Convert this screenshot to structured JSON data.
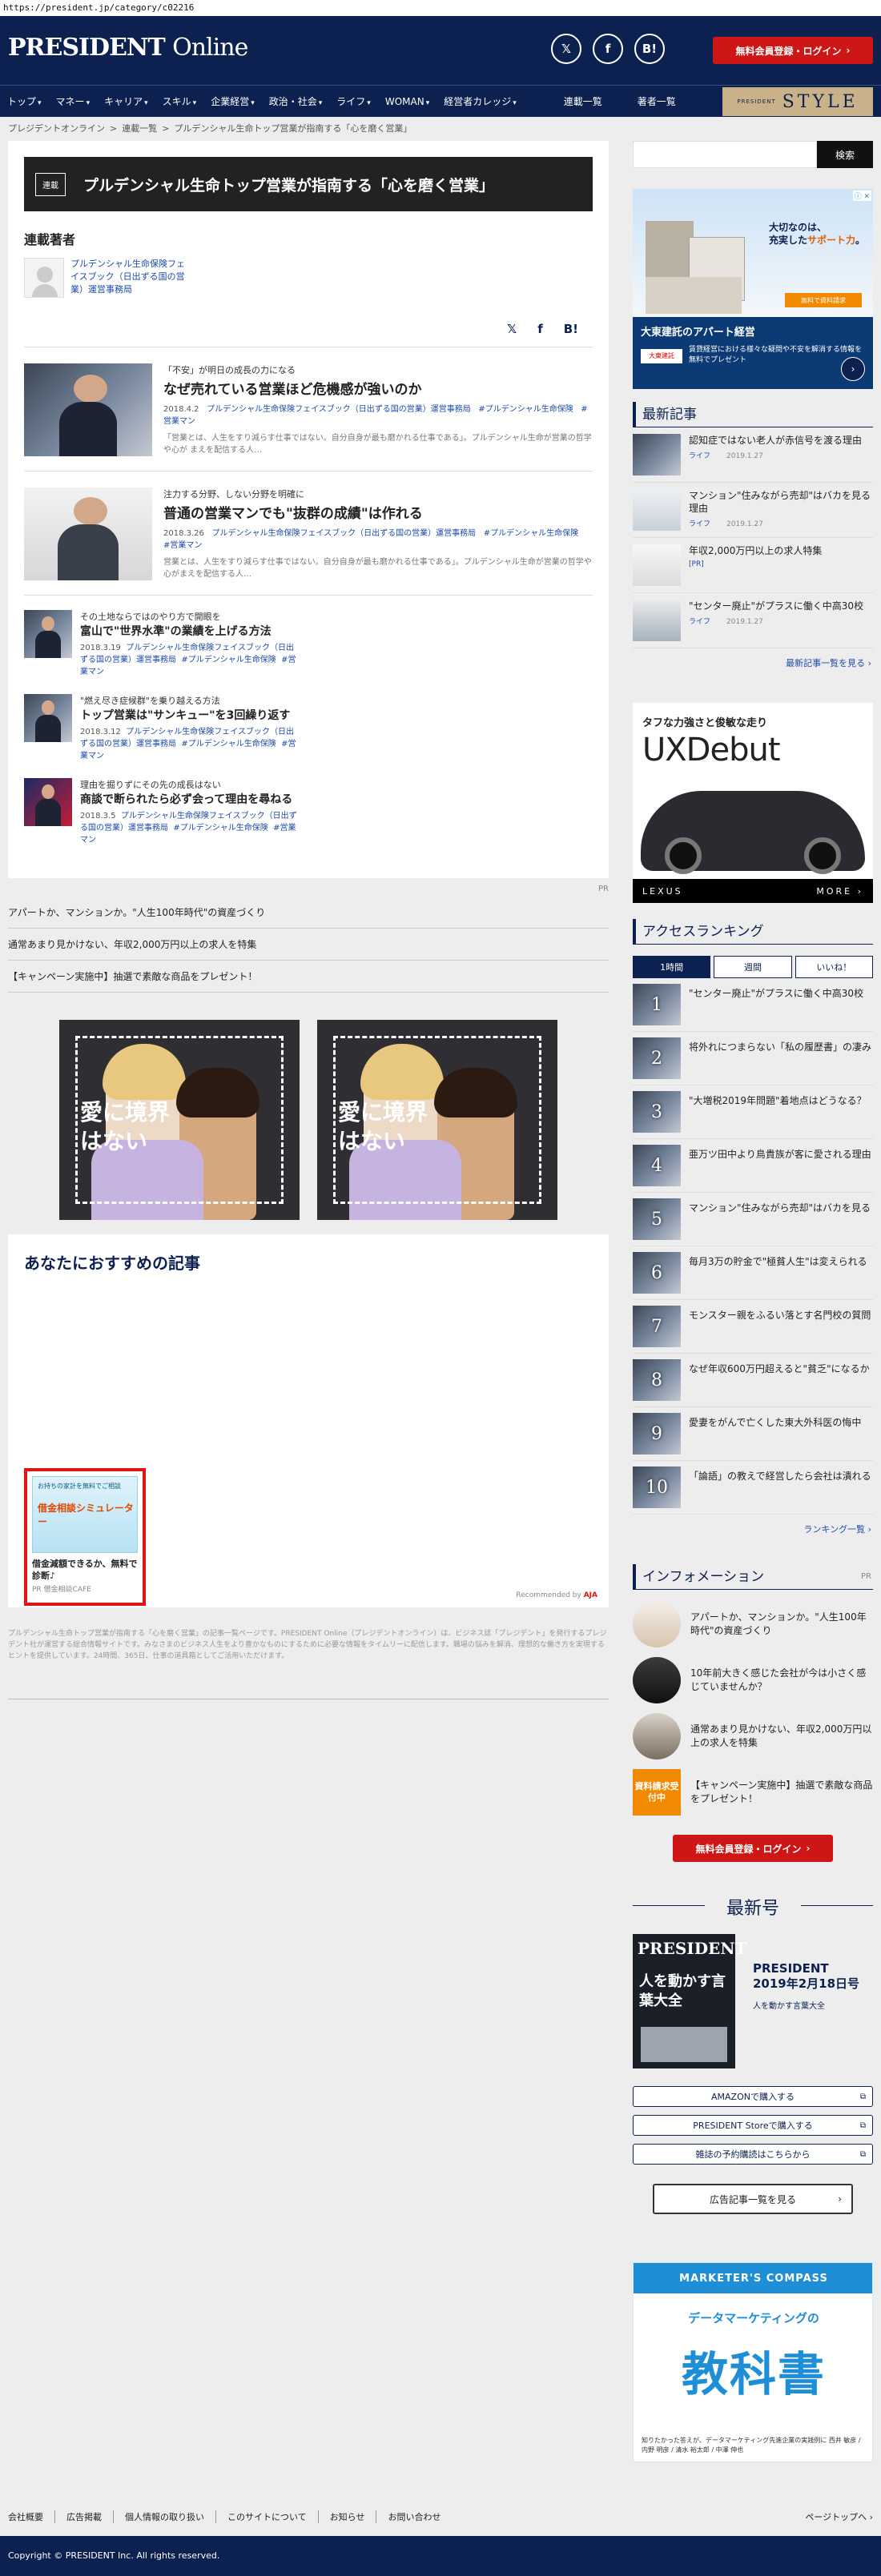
{
  "url": "https://president.jp/category/c02216",
  "header": {
    "logo_main": "PRESIDENT",
    "logo_sub": "Online",
    "social": [
      "twitter-icon",
      "facebook-icon",
      "hatena-icon"
    ],
    "social_labels": [
      "𝕏",
      "f",
      "B!"
    ],
    "register_label": "無料会員登録・ログイン",
    "register_chevron": "›"
  },
  "nav": {
    "items": [
      "トップ",
      "マネー",
      "キャリア",
      "スキル",
      "企業経営",
      "政治・社会",
      "ライフ",
      "WOMAN",
      "経営者カレッジ"
    ],
    "caret": "▾",
    "side_items": [
      "連載一覧",
      "著者一覧"
    ],
    "style_prefix": "PRESIDENT",
    "style_word": "STYLE"
  },
  "breadcrumb": [
    "プレジデントオンライン",
    "連載一覧",
    "プルデンシャル生命トップ営業が指南する「心を磨く営業」"
  ],
  "breadcrumb_sep": ">",
  "series": {
    "tag": "連載",
    "title": "プルデンシャル生命トップ営業が指南する「心を磨く営業」",
    "authors_heading": "連載著者",
    "author_name": "プルデンシャル生命保険フェイスブック（日出ずる国の営業）運営事務局",
    "share_labels": [
      "𝕏",
      "f",
      "B!"
    ]
  },
  "articles_big": [
    {
      "kicker": "「不安」が明日の成長の力になる",
      "title": "なぜ売れている営業ほど危機感が強いのか",
      "date": "2018.4.2",
      "author": "プルデンシャル生命保険フェイスブック（日出ずる国の営業）運営事務局",
      "tags": [
        "#プルデンシャル生命保険",
        "#営業マン"
      ],
      "desc": "「営業とは、人生をすり減らす仕事ではない。自分自身が最も磨かれる仕事である」。プルデンシャル生命が営業の哲学や心が まえを配信する人…"
    },
    {
      "kicker": "注力する分野、しない分野を明確に",
      "title": "普通の営業マンでも\"抜群の成績\"は作れる",
      "date": "2018.3.26",
      "author": "プルデンシャル生命保険フェイスブック（日出ずる国の営業）運営事務局",
      "tags": [
        "#プルデンシャル生命保険",
        "#営業マン"
      ],
      "desc": "営業とは、人生をすり減らす仕事ではない。自分自身が最も磨かれる仕事である」。プルデンシャル生命が営業の哲学や心がまえを配信する人…"
    }
  ],
  "articles_small": [
    {
      "kicker": "その土地ならではのやり方で開眼を",
      "title": "富山で\"世界水準\"の業績を上げる方法",
      "date": "2018.3.19",
      "author": "プルデンシャル生命保険フェイスブック（日出ずる国の営業）運営事務局",
      "tags": [
        "#プルデンシャル生命保険",
        "#営業マン"
      ]
    },
    {
      "kicker": "\"燃え尽き症候群\"を乗り越える方法",
      "title": "トップ営業は\"サンキュー\"を3回繰り返す",
      "date": "2018.3.12",
      "author": "プルデンシャル生命保険フェイスブック（日出ずる国の営業）運営事務局",
      "tags": [
        "#プルデンシャル生命保険",
        "#営業マン"
      ]
    },
    {
      "kicker": "理由を掘りずにその先の成長はない",
      "title": "商談で断られたら必ず会って理由を尋ねる",
      "date": "2018.3.5",
      "author": "プルデンシャル生命保険フェイスブック（日出ずる国の営業）運営事務局",
      "tags": [
        "#プルデンシャル生命保険",
        "#営業マン"
      ]
    }
  ],
  "pr": {
    "label": "PR",
    "rows": [
      "アパートか、マンションか。\"人生100年時代\"の資産づくり",
      "通常あまり見かけない、年収2,000万円以上の求人を特集",
      "【キャンペーン実施中】抽選で素敵な商品をプレゼント！"
    ],
    "ad_copy": "愛に境界はない"
  },
  "recommend": {
    "heading": "あなたにおすすめの記事",
    "ad_tile_top": "お持ちの家計を無料でご相談",
    "ad_tile_big": "借金相談シミュレーター",
    "ad_title": "借金減額できるか、無料で診断♪",
    "ad_source": "PR 借金相談CAFE",
    "recommended_by": "Recommended by",
    "recommended_brand": "AJA"
  },
  "footer_desc": "プルデンシャル生命トップ営業が指南する「心を磨く営業」の記事一覧ページです。PRESIDENT Online（プレジデントオンライン）は、ビジネス誌「プレジデント」を発行するプレジデント社が運営する総合情報サイトです。みなさまのビジネス人生をより豊かなものにするために必要な情報をタイムリーに配信します。職場の悩みを解消、理想的な働き方を実現するヒントを提供しています。24時間、365日、仕事の道具箱としてご活用いただけます。",
  "sidebar": {
    "search_button": "検索",
    "ad_house": {
      "head_line1": "大切なのは、",
      "head_line2": "充実した",
      "head_red": "サポート力",
      "head_end": "。",
      "orange": "無料で資料請求",
      "title": "大東建託のアパート経営",
      "logo": "大東建託",
      "body": "賃貸経営における様々な疑問や不安を解消する情報を無料でプレゼント",
      "arrow": "›",
      "adtag": "ⓘ ✕"
    },
    "latest_heading": "最新記事",
    "latest": [
      {
        "title": "認知症ではない老人が赤信号を渡る理由",
        "cat": "ライフ",
        "date": "2019.1.27"
      },
      {
        "title": "マンション\"住みながら売却\"はバカを見る理由",
        "cat": "ライフ",
        "date": "2019.1.27"
      },
      {
        "title": "年収2,000万円以上の求人特集",
        "cat": "[PR]",
        "date": ""
      },
      {
        "title": "\"センター廃止\"がプラスに働く中高30校",
        "cat": "ライフ",
        "date": "2019.1.27"
      }
    ],
    "latest_more": "最新記事一覧を見る ›",
    "ad_car": {
      "t1": "タフな力強さと俊敏な走り",
      "t2": "UXDebut",
      "brand": "LEXUS",
      "more": "MORE ›"
    },
    "ranking_heading": "アクセスランキング",
    "ranking_tabs": [
      "1時間",
      "週間",
      "いいね！"
    ],
    "ranking": [
      {
        "no": "1",
        "title": "\"センター廃止\"がプラスに働く中高30校"
      },
      {
        "no": "2",
        "title": "将外れにつまらない「私の履歴書」の凄み"
      },
      {
        "no": "3",
        "title": "\"大増税2019年問題\"着地点はどうなる？"
      },
      {
        "no": "4",
        "title": "亜万ツ田中より鳥貴族が客に愛される理由"
      },
      {
        "no": "5",
        "title": "マンション\"住みながら売却\"はバカを見る"
      },
      {
        "no": "6",
        "title": "毎月3万の貯金で\"極貧人生\"は変えられる"
      },
      {
        "no": "7",
        "title": "モンスター親をふるい落とす名門校の質問"
      },
      {
        "no": "8",
        "title": "なぜ年収600万円超えると\"貧乏\"になるか"
      },
      {
        "no": "9",
        "title": "愛妻をがんで亡くした東大外科医の悔中"
      },
      {
        "no": "10",
        "title": "「論語」の教えで経営したら会社は潰れる"
      }
    ],
    "ranking_more": "ランキング一覧 ›",
    "info_heading": "インフォメーション",
    "info_pr": "PR",
    "info": [
      {
        "title": "アパートか、マンションか。\"人生100年時代\"の資産づくり"
      },
      {
        "title": "10年前大きく感じた会社が今は小さく感じていませんか？"
      },
      {
        "title": "通常あまり見かけない、年収2,000万円以上の求人を特集"
      },
      {
        "title": "【キャンペーン実施中】抽選で素敵な商品をプレゼント！",
        "badge": "資料請求受付中"
      }
    ],
    "register_label": "無料会員登録・ログイン",
    "register_chevron": "›",
    "mag_heading": "最新号",
    "mag": {
      "cover_title": "PRESIDENT",
      "cover_sub": "人を動かす言葉大全",
      "name": "PRESIDENT",
      "issue": "2019年2月18日号",
      "sub": "人を動かす言葉大全"
    },
    "buy_buttons": [
      "AMAZONで購入する",
      "PRESIDENT Storeで購入する",
      "雑誌の予約購読はこちらから"
    ],
    "ad_list_button": "広告記事一覧を見る",
    "ad_list_chev": "›",
    "ad_marketer": {
      "band": "MARKETER'S COMPASS",
      "small": "データマーケティングの",
      "big": "教科書",
      "credit": "知りたかった答えが、データマーケティング先進企業の実践例に 西井 敏彦 / 内野 明彦 / 清水 裕太郎 / 中澤 伸也"
    }
  },
  "footer": {
    "links": [
      "会社概要",
      "広告掲載",
      "個人情報の取り扱い",
      "このサイトについて",
      "お知らせ",
      "お問い合わせ"
    ],
    "page_top": "ページトップへ ›",
    "copyright": "Copyright © PRESIDENT Inc. All rights reserved."
  }
}
